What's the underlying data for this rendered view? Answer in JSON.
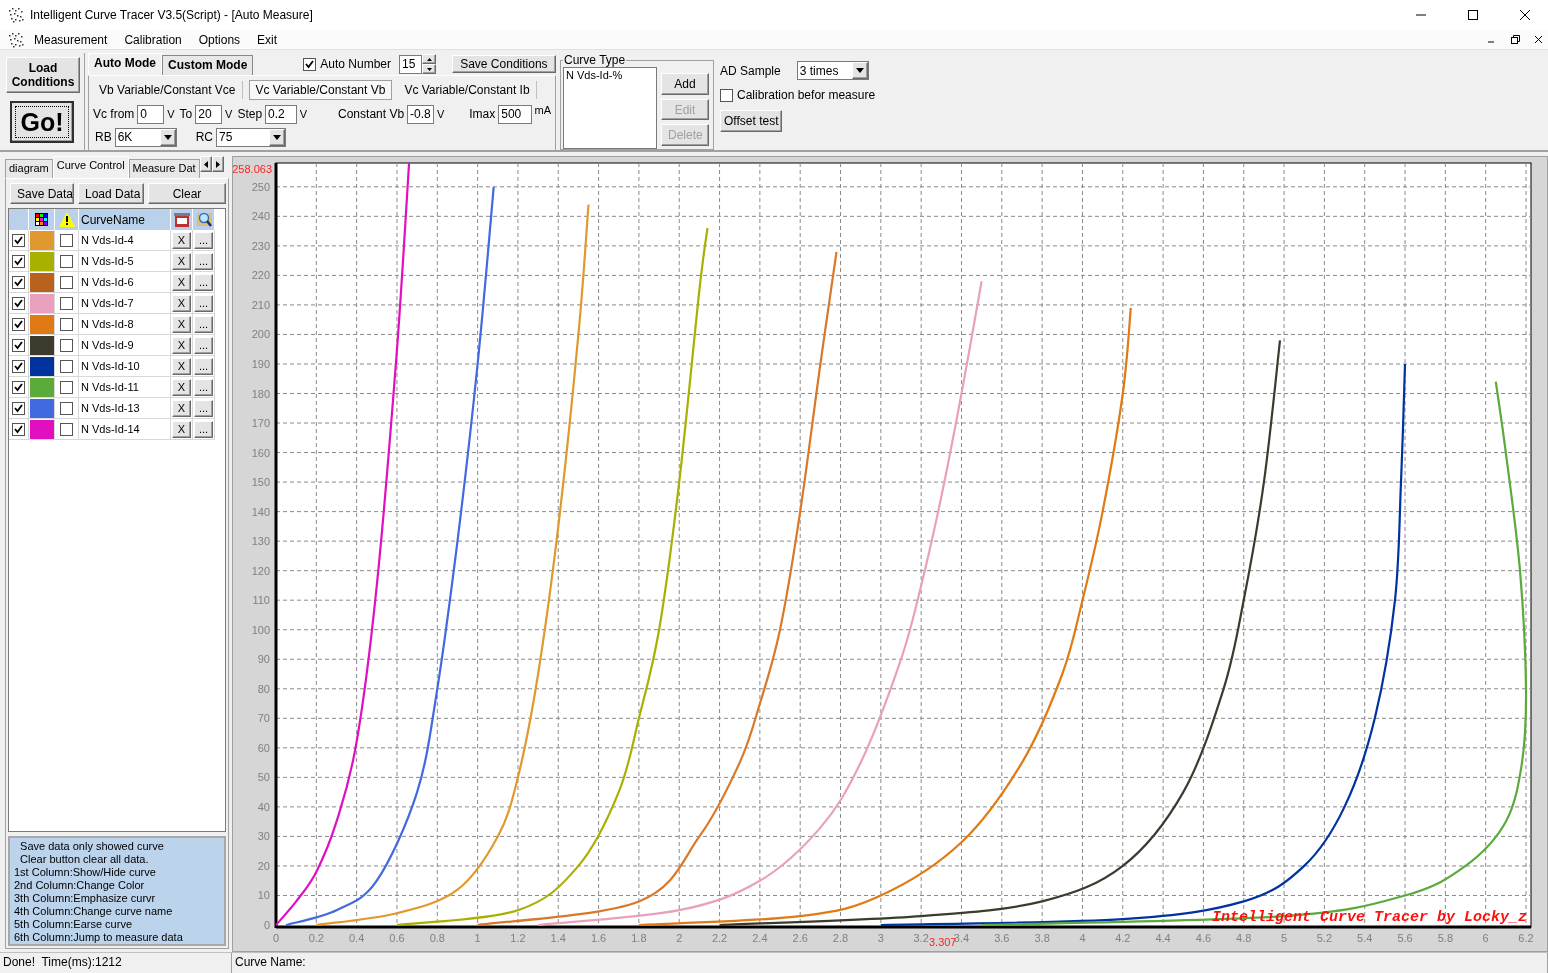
{
  "window": {
    "title": "Intelligent Curve Tracer V3.5(Script) - [Auto Measure]"
  },
  "menu": [
    {
      "label": "Measurement"
    },
    {
      "label": "Calibration"
    },
    {
      "label": "Options"
    },
    {
      "label": "Exit"
    }
  ],
  "toolbar": {
    "load_button": {
      "label": "Load Conditions"
    },
    "go_button": {
      "label": "Go!"
    },
    "mode_tabs": [
      {
        "label": "Auto Mode",
        "selected": true
      },
      {
        "label": "Custom Mode",
        "selected": false
      }
    ],
    "auto_number": {
      "label": "Auto Number",
      "checked": true,
      "value": "15"
    },
    "save_conditions": {
      "label": "Save Conditions"
    },
    "sweep_tabs": [
      {
        "label": "Vb Variable/Constant Vce",
        "selected": false
      },
      {
        "label": "Vc Variable/Constant Vb",
        "selected": true
      },
      {
        "label": "Vc Variable/Constant Ib",
        "selected": false
      }
    ],
    "params": [
      {
        "label": "Vc from",
        "value": "0",
        "unit": "V"
      },
      {
        "label": "To",
        "value": "20",
        "unit": "V"
      },
      {
        "label": "Step",
        "value": "0.2",
        "unit": "V"
      },
      {
        "label": "Constant Vb",
        "value": "-0.8",
        "unit": "V"
      },
      {
        "label": "Imax",
        "value": "500",
        "unit": "mA"
      }
    ],
    "selects": [
      {
        "label": "RB",
        "value": "6K"
      },
      {
        "label": "RC",
        "value": "75"
      }
    ],
    "curve_type": {
      "title": "Curve Type",
      "items": [
        "N Vds-Id-%"
      ],
      "buttons": [
        {
          "label": "Add",
          "disabled": false
        },
        {
          "label": "Edit",
          "disabled": true
        },
        {
          "label": "Delete",
          "disabled": true
        }
      ]
    },
    "ad_sample": {
      "label": "AD Sample",
      "value": "3 times"
    },
    "calibration": {
      "label": "Calibration befor measure",
      "checked": false
    },
    "offset_test": {
      "label": "Offset test"
    }
  },
  "left_panel": {
    "tabs": [
      {
        "label": "diagram",
        "selected": false
      },
      {
        "label": "Curve Control",
        "selected": true
      },
      {
        "label": "Measure Dat",
        "selected": false
      }
    ],
    "buttons": [
      "Save Data",
      "Load Data",
      "Clear"
    ],
    "table": {
      "name_column": "CurveName",
      "rows": [
        {
          "visible": true,
          "color": "#e0992e",
          "emphasize": false,
          "name": "N Vds-Id-4",
          "erase": "X",
          "jump": "..."
        },
        {
          "visible": true,
          "color": "#a8b000",
          "emphasize": false,
          "name": "N Vds-Id-5",
          "erase": "X",
          "jump": "..."
        },
        {
          "visible": true,
          "color": "#b8621e",
          "emphasize": false,
          "name": "N Vds-Id-6",
          "erase": "X",
          "jump": "..."
        },
        {
          "visible": true,
          "color": "#e9a0bd",
          "emphasize": false,
          "name": "N Vds-Id-7",
          "erase": "X",
          "jump": "..."
        },
        {
          "visible": true,
          "color": "#e07a14",
          "emphasize": false,
          "name": "N Vds-Id-8",
          "erase": "X",
          "jump": "..."
        },
        {
          "visible": true,
          "color": "#3d3a2e",
          "emphasize": false,
          "name": "N Vds-Id-9",
          "erase": "X",
          "jump": "..."
        },
        {
          "visible": true,
          "color": "#0033a0",
          "emphasize": false,
          "name": "N Vds-Id-10",
          "erase": "X",
          "jump": "..."
        },
        {
          "visible": true,
          "color": "#5aab3c",
          "emphasize": false,
          "name": "N Vds-Id-11",
          "erase": "X",
          "jump": "..."
        },
        {
          "visible": true,
          "color": "#4169e0",
          "emphasize": false,
          "name": "N Vds-Id-13",
          "erase": "X",
          "jump": "..."
        },
        {
          "visible": true,
          "color": "#e010c0",
          "emphasize": false,
          "name": "N Vds-Id-14",
          "erase": "X",
          "jump": "..."
        }
      ]
    },
    "help_lines": [
      "  Save data only showed curve",
      "  Clear button clear all data.",
      "1st Column:Show/Hide curve",
      "2nd Column:Change Color",
      "3th Column:Emphasize curvr",
      "4th Column:Change curve name",
      "5th Column:Earse curve",
      "6th Column:Jump to measure data"
    ]
  },
  "chart": {
    "chart_data": {
      "type": "line",
      "grid": true,
      "xlim": [
        0,
        6.2
      ],
      "ylim": [
        0,
        258.063
      ],
      "xticks": [
        0,
        0.2,
        0.4,
        0.6,
        0.8,
        1,
        1.2,
        1.4,
        1.6,
        1.8,
        2,
        2.2,
        2.4,
        2.6,
        2.8,
        3,
        3.2,
        3.4,
        3.6,
        3.8,
        4,
        4.2,
        4.4,
        4.6,
        4.8,
        5,
        5.2,
        5.4,
        5.6,
        5.8,
        6,
        6.2
      ],
      "yticks": [
        0,
        10,
        20,
        30,
        40,
        50,
        60,
        70,
        80,
        90,
        100,
        110,
        120,
        130,
        140,
        150,
        160,
        170,
        180,
        190,
        200,
        210,
        220,
        230,
        240,
        250
      ],
      "series": [
        {
          "color": "#e0992e",
          "x": [
            0.2,
            0.6,
            0.9,
            1.1,
            1.2,
            1.3,
            1.4,
            1.5,
            1.55
          ],
          "values": [
            0,
            4,
            12,
            30,
            50,
            85,
            135,
            200,
            244
          ]
        },
        {
          "color": "#a8b000",
          "x": [
            0.6,
            1.2,
            1.5,
            1.7,
            1.8,
            1.9,
            2.0,
            2.1,
            2.14
          ],
          "values": [
            0,
            5,
            20,
            45,
            70,
            100,
            150,
            215,
            236
          ]
        },
        {
          "color": "#d8782a",
          "x": [
            1.0,
            1.8,
            2.1,
            2.3,
            2.4,
            2.5,
            2.6,
            2.7,
            2.78
          ],
          "values": [
            0,
            8,
            30,
            55,
            75,
            100,
            140,
            190,
            228
          ]
        },
        {
          "color": "#e9a0bd",
          "x": [
            1.3,
            2.0,
            2.4,
            2.7,
            2.9,
            3.1,
            3.2,
            3.3,
            3.4,
            3.5
          ],
          "values": [
            0,
            5,
            15,
            33,
            55,
            90,
            115,
            145,
            180,
            218
          ]
        },
        {
          "color": "#e07a14",
          "x": [
            1.8,
            2.6,
            3.0,
            3.4,
            3.7,
            3.9,
            4.0,
            4.1,
            4.2,
            4.24
          ],
          "values": [
            0,
            3,
            10,
            28,
            55,
            85,
            110,
            140,
            180,
            209
          ]
        },
        {
          "color": "#3d3a2e",
          "x": [
            2.2,
            3.2,
            3.8,
            4.2,
            4.5,
            4.7,
            4.8,
            4.9,
            4.98
          ],
          "values": [
            0,
            3,
            8,
            20,
            45,
            80,
            110,
            150,
            198
          ]
        },
        {
          "color": "#0033a0",
          "x": [
            3.0,
            4.2,
            4.8,
            5.1,
            5.3,
            5.45,
            5.55,
            5.58,
            5.6
          ],
          "values": [
            0,
            2,
            8,
            20,
            40,
            70,
            110,
            150,
            190
          ]
        },
        {
          "color": "#5aab3c",
          "x": [
            3.5,
            5.0,
            5.6,
            5.9,
            6.1,
            6.18,
            6.2,
            6.17,
            6.1,
            6.05
          ],
          "values": [
            0,
            3,
            10,
            20,
            35,
            55,
            80,
            120,
            160,
            184
          ]
        },
        {
          "color": "#4169e0",
          "x": [
            0.05,
            0.3,
            0.5,
            0.7,
            0.8,
            0.9,
            1.0,
            1.08
          ],
          "values": [
            0,
            5,
            15,
            45,
            80,
            130,
            190,
            250
          ]
        },
        {
          "color": "#e010c0",
          "x": [
            0,
            0.1,
            0.2,
            0.3,
            0.4,
            0.5,
            0.6,
            0.66
          ],
          "values": [
            0,
            8,
            18,
            35,
            62,
            115,
            195,
            258
          ]
        }
      ],
      "annotations": [
        {
          "text": "258.063"
        },
        {
          "text": "3.307"
        },
        {
          "text": "Intelligent Curve Tracer by Locky_z"
        }
      ]
    }
  },
  "status_bar": {
    "message": "Done!  Time(ms):1212",
    "curve_name": "Curve Name:"
  }
}
